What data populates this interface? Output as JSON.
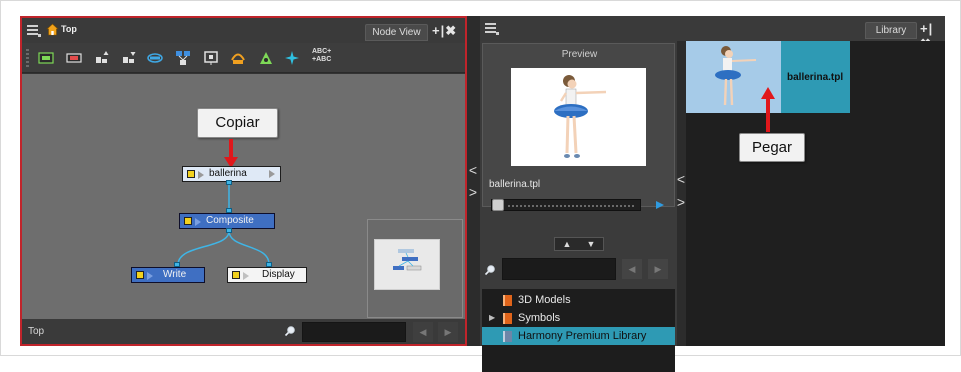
{
  "node_view": {
    "breadcrumb": "Top",
    "tab_label": "Node View",
    "tab_controls": "+|✖",
    "toolbar_icons": [
      "display-node-icon",
      "composite-node-icon",
      "move-up-icon",
      "move-down-icon",
      "peg-icon",
      "group-icon",
      "backdrop-icon",
      "camera-icon",
      "drawing-icon",
      "effect-icon",
      "abc-icon"
    ],
    "abc_top": "ABC+",
    "abc_bottom": "+ABC",
    "nodes": {
      "ballerina": "ballerina",
      "composite": "Composite",
      "write": "Write",
      "display": "Display"
    },
    "callout_copy": "Copiar",
    "status_label": "Top",
    "nav_prev": "◀",
    "nav_next": "▶"
  },
  "library": {
    "tab_label": "Library",
    "tab_controls": "+|✖",
    "preview_title": "Preview",
    "preview_name": "ballerina.tpl",
    "up_label": "▲",
    "down_label": "▼",
    "tree": [
      {
        "label": "3D Models",
        "expander": "",
        "selected": false
      },
      {
        "label": "Symbols",
        "expander": "▶",
        "selected": false
      },
      {
        "label": "Harmony Premium Library",
        "expander": "",
        "selected": true
      }
    ],
    "item_name": "ballerina.tpl",
    "callout_paste": "Pegar",
    "nav_prev": "◀",
    "nav_next": "▶"
  },
  "splitter": {
    "left": "<",
    "right": ">"
  },
  "colors": {
    "highlight": "#2e9ab4",
    "node_selected": "#3f6fc2",
    "port": "#3fb5e6",
    "callout_arrow": "#e0171b",
    "panel_border": "#c0242b"
  }
}
